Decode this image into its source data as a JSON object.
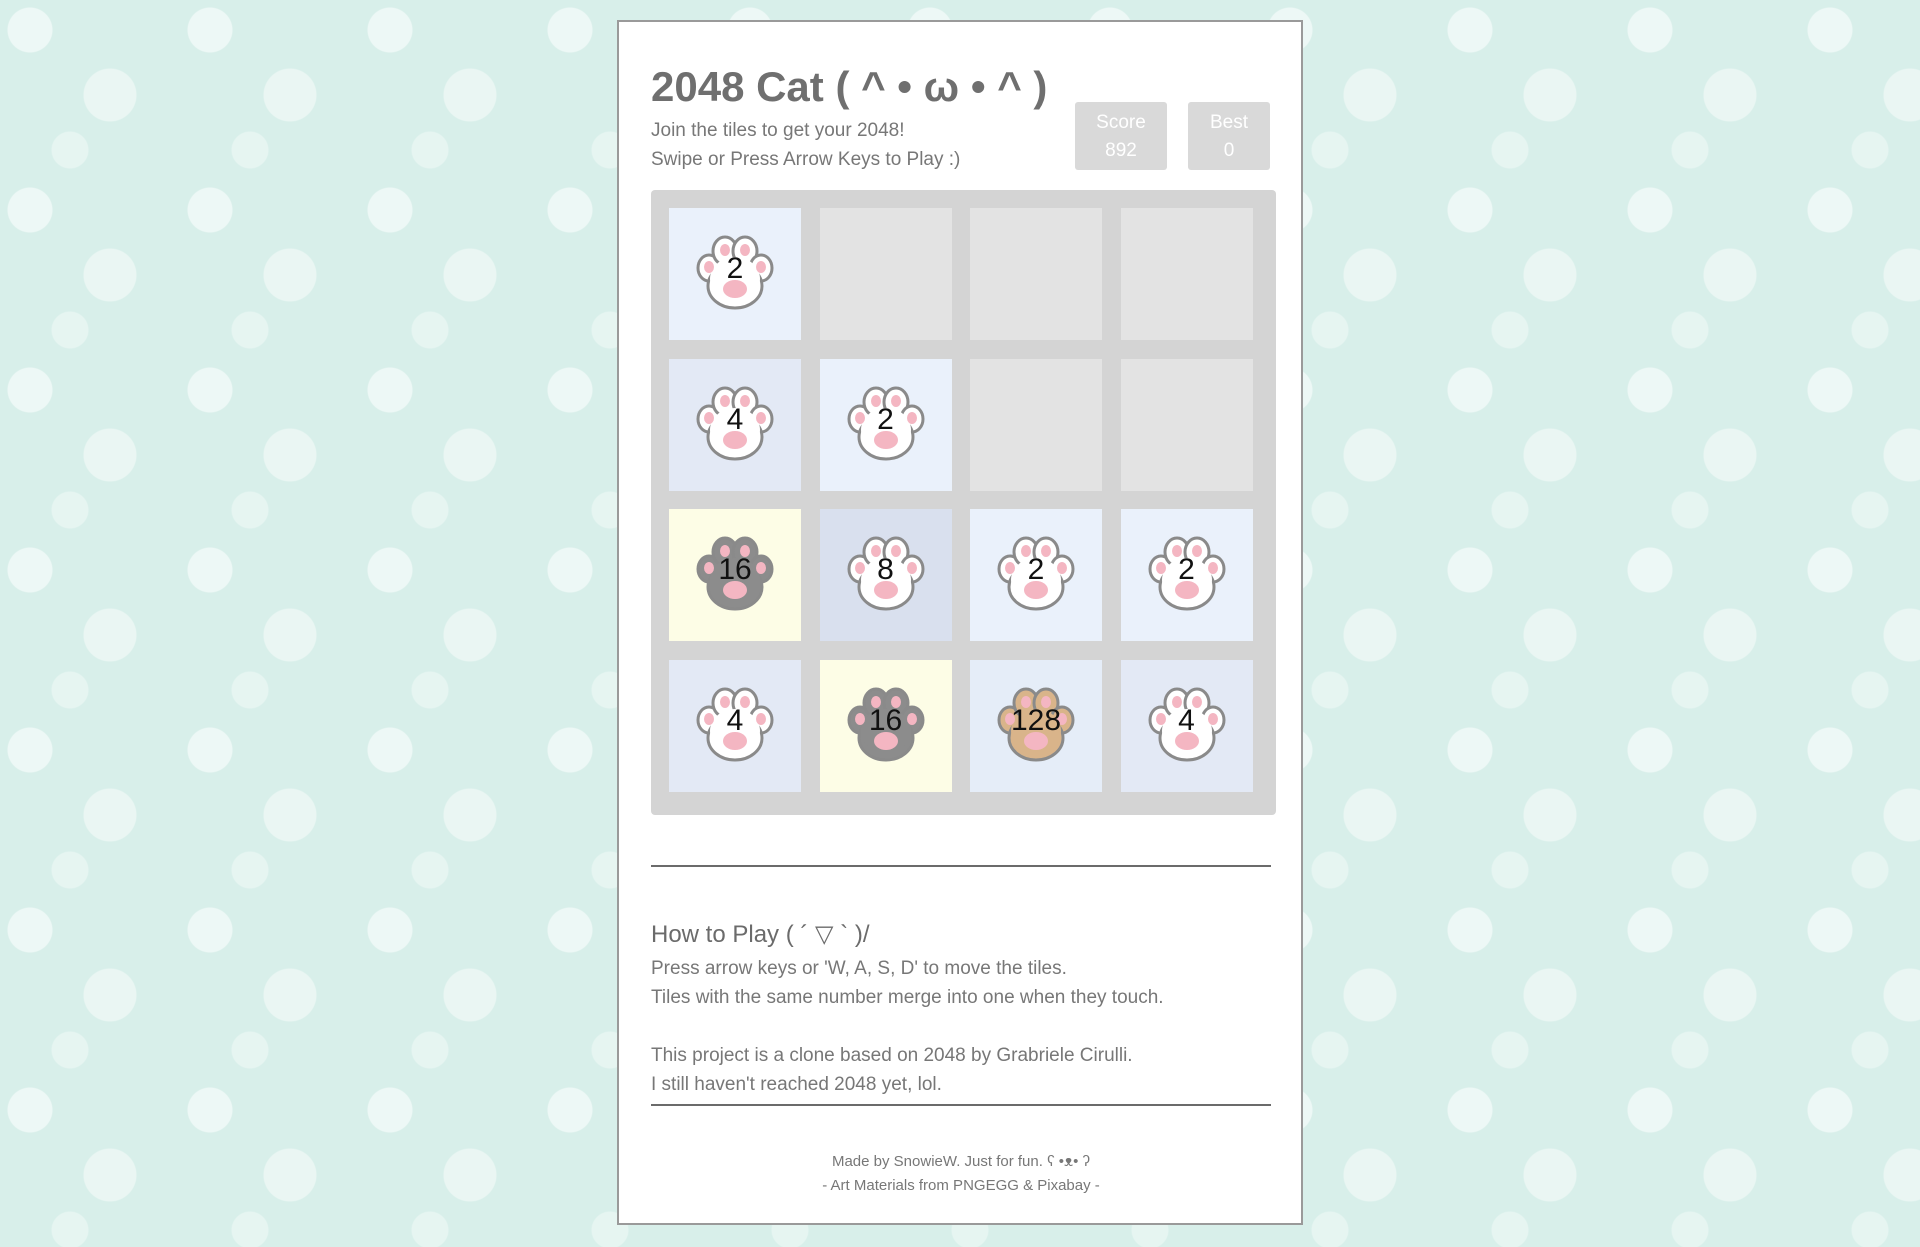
{
  "header": {
    "title": "2048 Cat ( ^ • ω • ^ )",
    "subtitle_line1": "Join the tiles to get your 2048!",
    "subtitle_line2": "Swipe or Press Arrow Keys to Play :)"
  },
  "scores": {
    "score_label": "Score",
    "score_value": "892",
    "best_label": "Best",
    "best_value": "0"
  },
  "board": {
    "rows": [
      [
        2,
        null,
        null,
        null
      ],
      [
        4,
        2,
        null,
        null
      ],
      [
        16,
        8,
        2,
        2
      ],
      [
        4,
        16,
        128,
        4
      ]
    ]
  },
  "colors": {
    "paw_light": "#ffffff",
    "paw_dark": "#8c8c8c",
    "paw_tan": "#d9b48a",
    "pad_pink": "#f4b6c2",
    "paw_outline": "#8a8a8a"
  },
  "howto": {
    "heading": "How to Play ( ´ ▽ ` )/",
    "line1": "Press arrow keys or 'W, A, S, D' to move the tiles.",
    "line2": "Tiles with the same number merge into one when they touch.",
    "line3": "This project is a clone based on 2048 by Grabriele Cirulli.",
    "line4": "I still haven't reached 2048 yet, lol."
  },
  "footer": {
    "line1": "Made by SnowieW. Just for fun. ʕ •ᴥ• ʔ",
    "line2": "- Art Materials from PNGEGG & Pixabay -"
  }
}
